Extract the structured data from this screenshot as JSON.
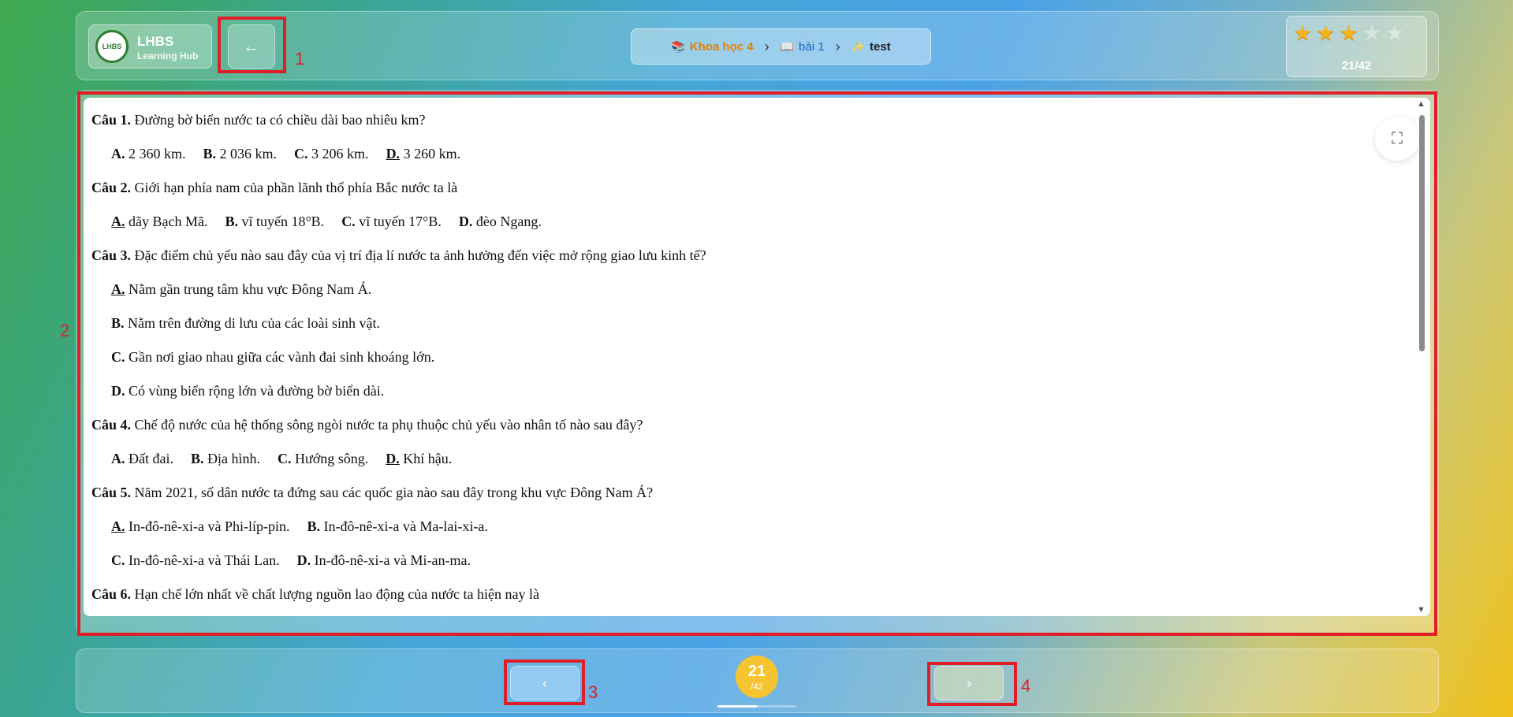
{
  "header": {
    "logo_badge": "LHBS",
    "logo_name": "LHBS",
    "logo_subtitle": "Learning Hub",
    "back_icon": "arrow-left-icon",
    "breadcrumb": [
      {
        "icon": "books-icon",
        "label": "Khoa học 4"
      },
      {
        "icon": "book-icon",
        "label": "bài 1"
      },
      {
        "icon": "sparkles-icon",
        "label": "test"
      }
    ],
    "stars_filled": 3,
    "stars_total": 5,
    "progress_label": "21/42"
  },
  "document": {
    "questions": [
      {
        "label": "Câu 1.",
        "text": " Đường bờ biển nước ta có chiều dài bao nhiêu km?",
        "option_lines": [
          [
            [
              "A.",
              " 2 360 km.",
              false
            ],
            [
              "B.",
              " 2 036 km.",
              false
            ],
            [
              "C.",
              " 3 206 km.",
              false
            ],
            [
              "D.",
              " 3 260 km.",
              true
            ]
          ]
        ]
      },
      {
        "label": "Câu 2.",
        "text": " Giới hạn phía nam của phần lãnh thổ phía Bắc nước ta là",
        "option_lines": [
          [
            [
              "A.",
              " dãy Bạch Mã.",
              true
            ],
            [
              "B.",
              " vĩ tuyến 18°B.",
              false
            ],
            [
              "C.",
              " vĩ tuyến 17°B.",
              false
            ],
            [
              "D.",
              " đèo Ngang.",
              false
            ]
          ]
        ]
      },
      {
        "label": "Câu 3.",
        "text": " Đặc điểm chủ yếu nào sau đây của vị trí địa lí nước ta ảnh hưởng đến việc mở rộng giao lưu kinh tế?",
        "option_lines": [
          [
            [
              "A.",
              " Nằm gần trung tâm khu vực Đông Nam Á.",
              true
            ]
          ],
          [
            [
              "B.",
              " Nằm trên đường di lưu của các loài sinh vật.",
              false
            ]
          ],
          [
            [
              "C.",
              " Gần nơi giao nhau giữa các vành đai sinh khoáng lớn.",
              false
            ]
          ],
          [
            [
              "D.",
              " Có vùng biển rộng lớn và đường bờ biển dài.",
              false
            ]
          ]
        ]
      },
      {
        "label": "Câu 4.",
        "text": " Chế độ nước của hệ thống sông ngòi nước ta phụ thuộc chủ yếu vào nhân tố nào sau đây?",
        "option_lines": [
          [
            [
              "A.",
              " Đất đai.",
              false
            ],
            [
              "B.",
              " Địa hình.",
              false
            ],
            [
              "C.",
              " Hướng sông.",
              false
            ],
            [
              "D.",
              " Khí hậu.",
              true
            ]
          ]
        ]
      },
      {
        "label": "Câu 5.",
        "text": " Năm 2021, số dân nước ta đứng sau các quốc gia nào sau đây trong khu vực Đông Nam Á?",
        "option_lines": [
          [
            [
              "A.",
              " In-đô-nê-xi-a và Phi-líp-pin.",
              true
            ],
            [
              "B.",
              " In-đô-nê-xi-a và Ma-lai-xi-a.",
              false
            ]
          ],
          [
            [
              "C.",
              " In-đô-nê-xi-a và Thái Lan.",
              false
            ],
            [
              "D.",
              " In-đô-nê-xi-a và Mi-an-ma.",
              false
            ]
          ]
        ]
      },
      {
        "label": "Câu 6.",
        "text": " Hạn chế lớn nhất về chất lượng nguồn lao động của nước ta hiện nay là",
        "option_lines": []
      }
    ],
    "expand_icon": "fullscreen-icon"
  },
  "footer": {
    "prev_label": "‹",
    "next_label": "›",
    "page_current": "21",
    "page_total": "/42",
    "progress_fraction": 0.5
  },
  "annotations": [
    "1",
    "2",
    "3",
    "4"
  ]
}
